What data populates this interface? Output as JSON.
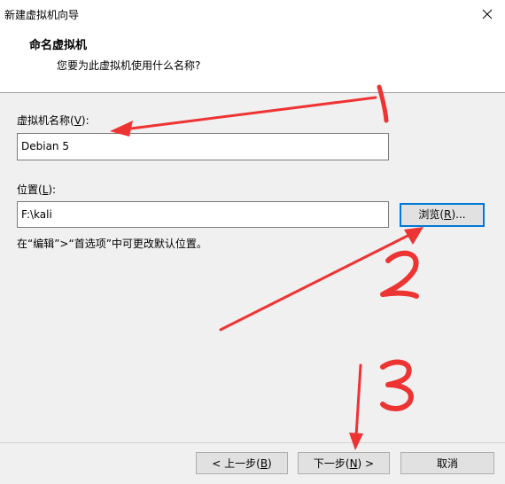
{
  "window": {
    "title": "新建虚拟机向导"
  },
  "header": {
    "title": "命名虚拟机",
    "subtitle": "您要为此虚拟机使用什么名称?"
  },
  "name_field": {
    "label_prefix": "虚拟机名称(",
    "label_key": "V",
    "label_suffix": "):",
    "value": "Debian 5"
  },
  "location_field": {
    "label_prefix": "位置(",
    "label_key": "L",
    "label_suffix": "):",
    "value": "F:\\kali"
  },
  "browse_button": {
    "prefix": "浏览(",
    "key": "R",
    "suffix": ")..."
  },
  "hint": "在“编辑”>“首选项”中可更改默认位置。",
  "footer": {
    "back": {
      "prefix": "< 上一步(",
      "key": "B",
      "suffix": ")"
    },
    "next": {
      "prefix": "下一步(",
      "key": "N",
      "suffix": ") >"
    },
    "cancel": "取消"
  },
  "colors": {
    "annotation": "#ee3333",
    "focus": "#0078d7"
  },
  "annotations": {
    "one": "1",
    "two": "2",
    "three": "3"
  }
}
